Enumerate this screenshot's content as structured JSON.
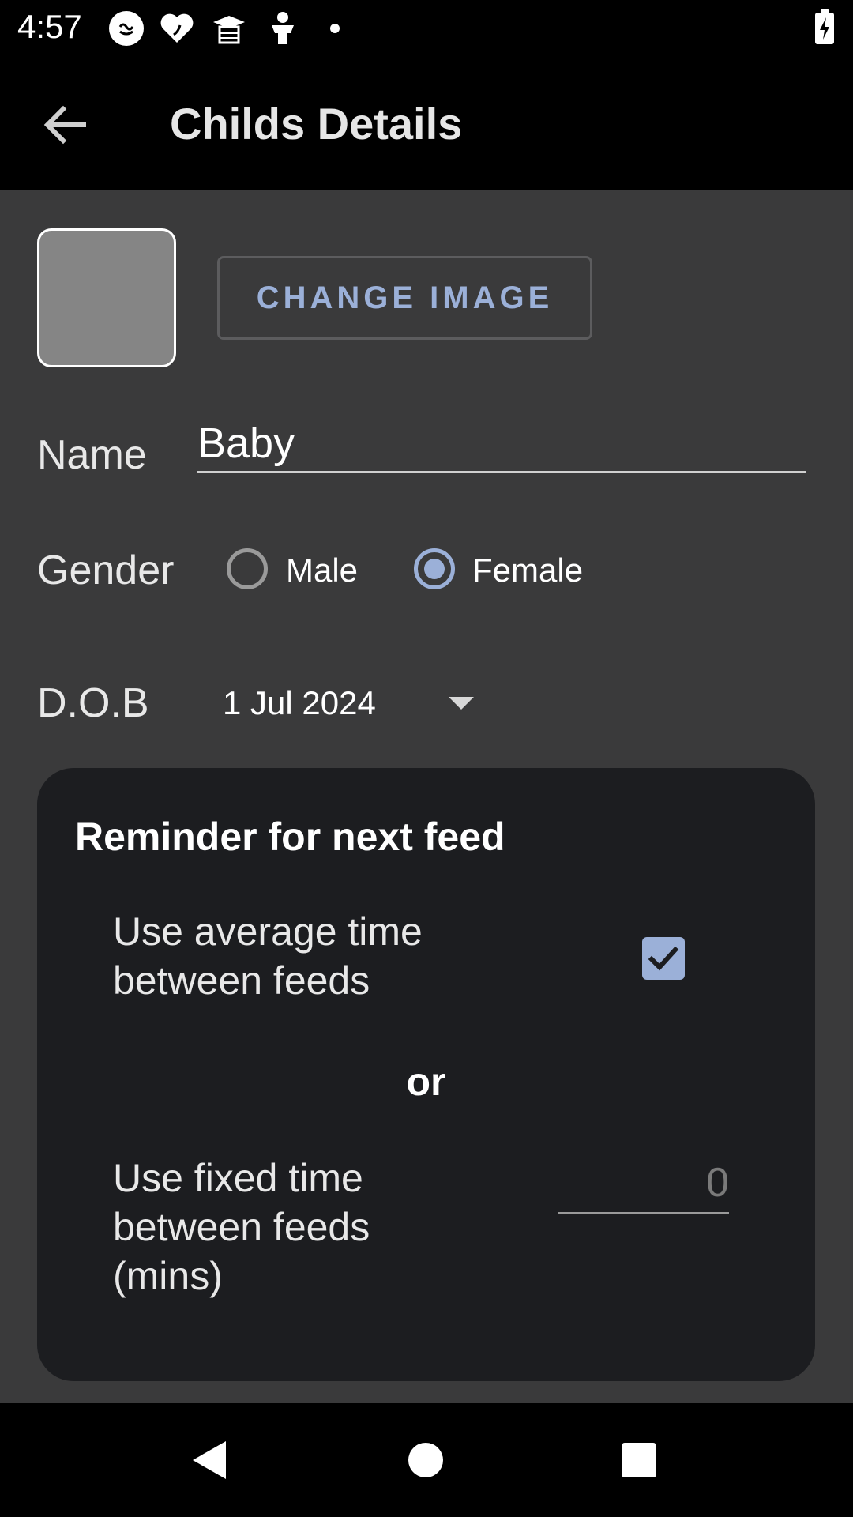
{
  "status_bar": {
    "time": "4:57",
    "icons": [
      "baby-face-icon",
      "heart-icon",
      "graduation-cap-icon",
      "baby-icon",
      "notification-dot-icon",
      "battery-charging-icon"
    ]
  },
  "app_bar": {
    "title": "Childs Details",
    "back_icon": "arrow-back-icon"
  },
  "profile": {
    "change_image_label": "CHANGE IMAGE"
  },
  "form": {
    "name_label": "Name",
    "name_value": "Baby",
    "gender_label": "Gender",
    "gender_options": [
      "Male",
      "Female"
    ],
    "gender_selected": "Female",
    "dob_label": "D.O.B",
    "dob_value": "1 Jul 2024"
  },
  "reminder": {
    "title": "Reminder for next feed",
    "average_line1": "Use average time",
    "average_line2": "between feeds",
    "average_checked": true,
    "or_label": "or",
    "fixed_line1": "Use fixed time",
    "fixed_line2": "between feeds",
    "fixed_line3": "(mins)",
    "fixed_value": "0"
  },
  "nav": {
    "items": [
      "back-nav-icon",
      "home-nav-icon",
      "recents-nav-icon"
    ]
  },
  "colors": {
    "accent": "#9bb0d8",
    "background": "#3a3a3b",
    "card": "#1c1d20",
    "bars": "#000000"
  }
}
